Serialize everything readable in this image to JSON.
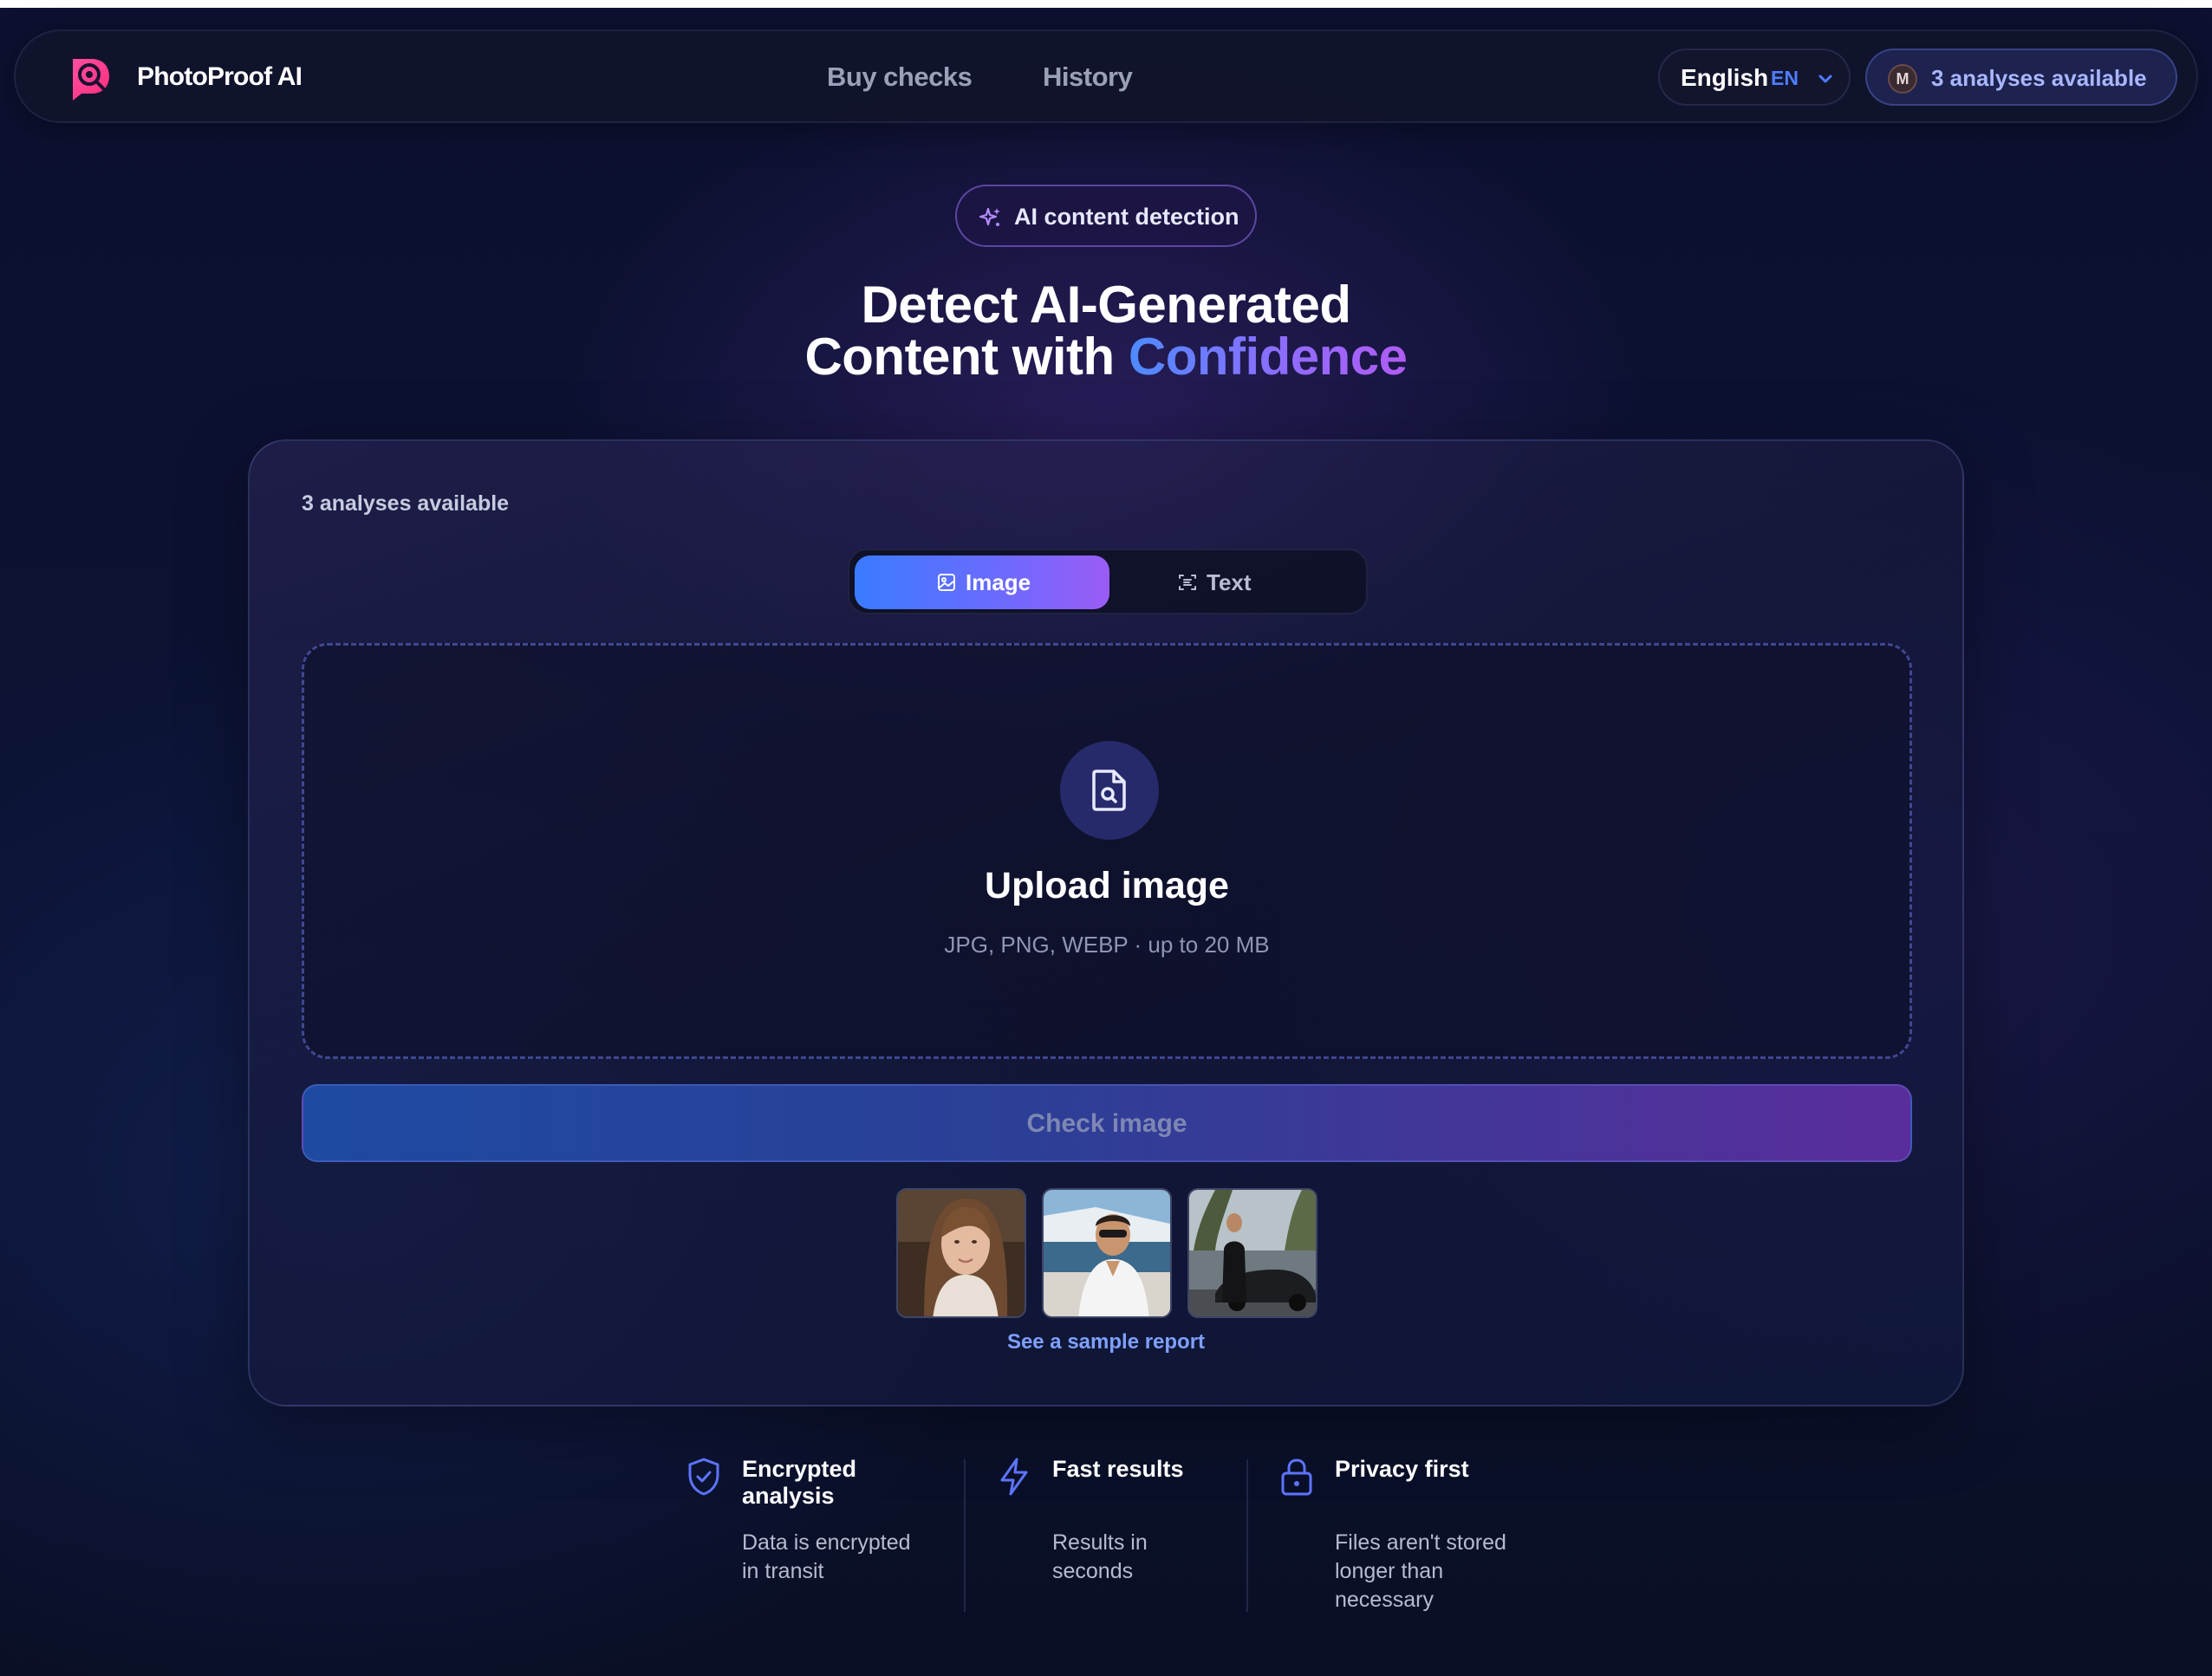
{
  "header": {
    "brand": "PhotoProof AI",
    "logo_icon": "photoproof-logo-icon",
    "nav": [
      {
        "label": "Buy checks"
      },
      {
        "label": "History"
      }
    ],
    "language": {
      "name": "English",
      "code": "EN",
      "icon": "chevron-down-icon"
    },
    "account": {
      "avatar_initial": "M",
      "credits_label": "3 analyses available"
    }
  },
  "hero": {
    "badge": {
      "icon": "sparkle-icon",
      "label": "AI content detection"
    },
    "title_line1": "Detect AI-Generated",
    "title_line2_prefix": "Content with ",
    "title_line2_accent": "Confidence"
  },
  "card": {
    "credits_label": "3 analyses available",
    "tabs": [
      {
        "label": "Image",
        "icon": "image-icon",
        "active": true
      },
      {
        "label": "Text",
        "icon": "text-scan-icon",
        "active": false
      }
    ],
    "dropzone": {
      "icon": "file-search-icon",
      "title": "Upload image",
      "subtitle": "JPG, PNG, WEBP · up to 20 MB"
    },
    "check_button": "Check image",
    "samples": [
      {
        "name": "sample-portrait-woman"
      },
      {
        "name": "sample-man-on-yacht"
      },
      {
        "name": "sample-man-with-car"
      }
    ],
    "sample_link": "See a sample report"
  },
  "features": [
    {
      "icon": "shield-check-icon",
      "title": "Encrypted analysis",
      "desc": "Data is encrypted in transit"
    },
    {
      "icon": "lightning-icon",
      "title": "Fast results",
      "desc": "Results in seconds"
    },
    {
      "icon": "lock-icon",
      "title": "Privacy first",
      "desc": "Files aren't stored longer than necessary"
    }
  ],
  "colors": {
    "accent_blue": "#3a7bff",
    "accent_purple": "#9a5cf6",
    "link": "#7ea0ff",
    "background": "#0d1030"
  }
}
